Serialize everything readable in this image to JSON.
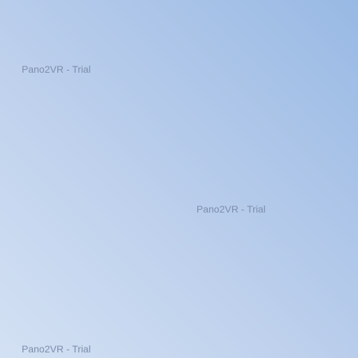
{
  "panorama": {
    "watermarks": [
      {
        "text": "Pano2VR - Trial"
      },
      {
        "text": "Pano2VR - Trial"
      },
      {
        "text": "Pano2VR - Trial"
      }
    ]
  },
  "colors": {
    "sky_light": "#d3e1f3",
    "sky_mid": "#bccfec",
    "sky_deep": "#98b9e4",
    "watermark_text": "#7d8eab"
  }
}
